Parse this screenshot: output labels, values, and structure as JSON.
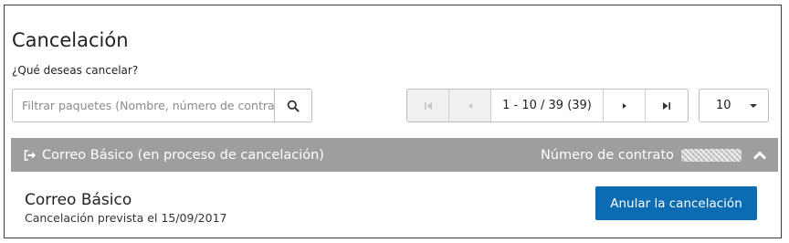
{
  "page": {
    "title": "Cancelación",
    "subtitle": "¿Qué deseas cancelar?"
  },
  "search": {
    "placeholder": "Filtrar paquetes (Nombre, número de contrato)",
    "value": "",
    "icon": "search-icon"
  },
  "pagination": {
    "range_text": "1 - 10 / 39 (39)",
    "first_icon": "first-page-icon",
    "prev_icon": "prev-page-icon",
    "next_icon": "next-page-icon",
    "last_icon": "last-page-icon"
  },
  "per_page": {
    "value": "10",
    "icon": "caret-down-icon"
  },
  "group": {
    "label": "Correo Básico (en proceso de cancelación)",
    "contract_label": "Número de contrato",
    "exit_icon": "sign-out-icon",
    "collapse_icon": "chevron-up-icon"
  },
  "item": {
    "name": "Correo Básico",
    "detail": "Cancelación prevista el 15/09/2017",
    "action_label": "Anular la cancelación"
  },
  "colors": {
    "accent": "#0c6cb3",
    "group_header": "#9e9e9e",
    "text": "#222222"
  }
}
